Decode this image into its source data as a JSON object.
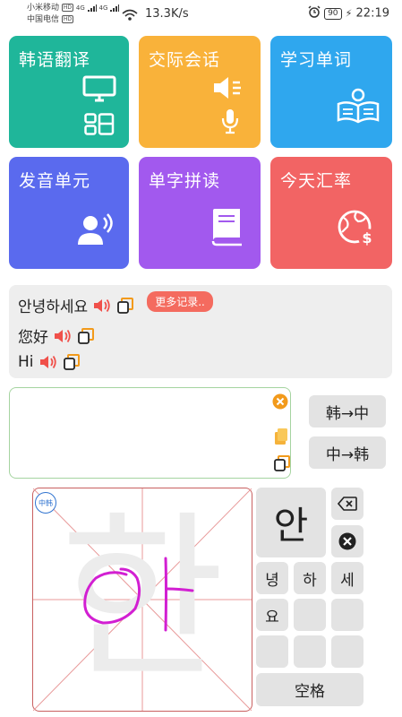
{
  "status_bar": {
    "carrier1": "小米移动",
    "carrier2": "中国电信",
    "hd": "HD",
    "net_speed": "13.3K/s",
    "battery": "90",
    "time": "22:19"
  },
  "tiles": [
    {
      "label": "韩语翻译",
      "color": "#1fb69a",
      "icon": "monitor-icon"
    },
    {
      "label": "交际会话",
      "color": "#f9b23a",
      "icon": "speaker-mic-icon"
    },
    {
      "label": "学习单词",
      "color": "#2fa7ee",
      "icon": "reading-icon"
    },
    {
      "label": "发音单元",
      "color": "#5a6aee",
      "icon": "speaking-person-icon"
    },
    {
      "label": "单字拼读",
      "color": "#a259ee",
      "icon": "book-icon"
    },
    {
      "label": "今天汇率",
      "color": "#f26464",
      "icon": "globe-dollar-icon"
    }
  ],
  "history": {
    "items": [
      {
        "text": "안녕하세요"
      },
      {
        "text": "您好"
      },
      {
        "text": "Hi"
      }
    ],
    "more_label": "更多记录.."
  },
  "input": {
    "value": "",
    "clear_icon": "clear-icon",
    "paste_icon": "paste-icon",
    "copy_icon": "copy-icon"
  },
  "direction_buttons": {
    "ko_to_zh": "韩→中",
    "zh_to_ko": "中→韩"
  },
  "handwriting": {
    "mode_badge": "中韩",
    "guide_char": "한"
  },
  "keypad": {
    "main_candidate": "안",
    "candidates": [
      "녕",
      "하",
      "세",
      "요",
      "",
      "",
      "",
      "",
      ""
    ],
    "space_label": "空格",
    "backspace_icon": "backspace-icon",
    "clear_icon": "clear-icon"
  },
  "colors": {
    "speaker": "#f0504a",
    "copy": "#f29a1b",
    "pad_border": "#c96060",
    "input_border": "#a5d4a0"
  }
}
